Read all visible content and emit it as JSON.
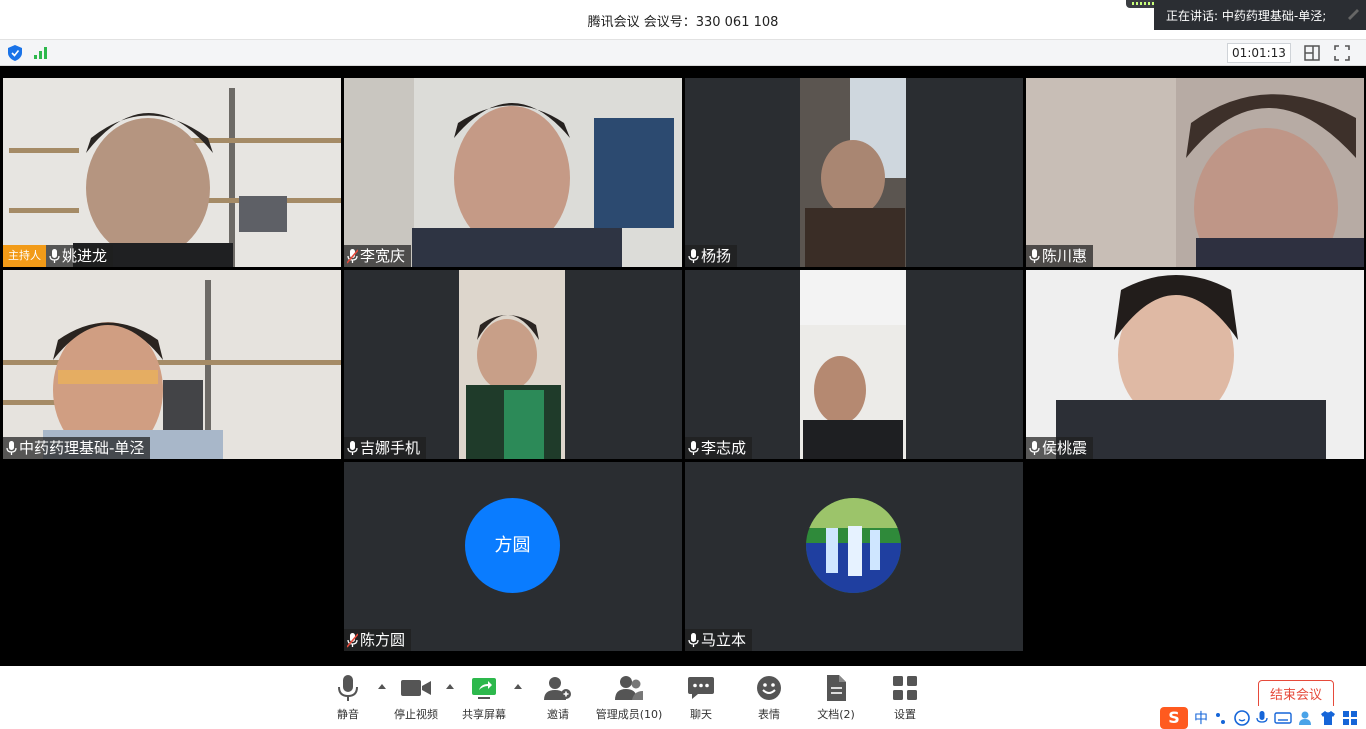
{
  "titlebar": {
    "title": "腾讯会议 会议号：330 061 108",
    "speaking": "正在讲话: 中药药理基础-单泾;"
  },
  "statusbar": {
    "timer": "01:01:13"
  },
  "participants": [
    {
      "name": "姚进龙",
      "host_label": "主持人",
      "muted": false
    },
    {
      "name": "李宽庆",
      "muted": true
    },
    {
      "name": "杨扬",
      "muted": false
    },
    {
      "name": "陈川惠",
      "muted": false
    },
    {
      "name": "中药药理基础-单泾",
      "muted": false
    },
    {
      "name": "吉娜手机",
      "muted": false
    },
    {
      "name": "李志成",
      "muted": false
    },
    {
      "name": "侯桃震",
      "muted": false
    },
    {
      "name": "陈方圆",
      "muted": true,
      "avatar_text": "方圆"
    },
    {
      "name": "马立本",
      "muted": false
    }
  ],
  "toolbar": {
    "mute": "静音",
    "stop_video": "停止视频",
    "share_screen": "共享屏幕",
    "invite": "邀请",
    "manage_members": "管理成员(10)",
    "chat": "聊天",
    "reactions": "表情",
    "docs": "文档(2)",
    "settings": "设置",
    "end_meeting": "结束会议"
  },
  "ime": {
    "logo": "S",
    "mode": "中"
  },
  "colors": {
    "accent": "#0a7cff",
    "host": "#f29b18",
    "danger": "#e64a3b"
  }
}
